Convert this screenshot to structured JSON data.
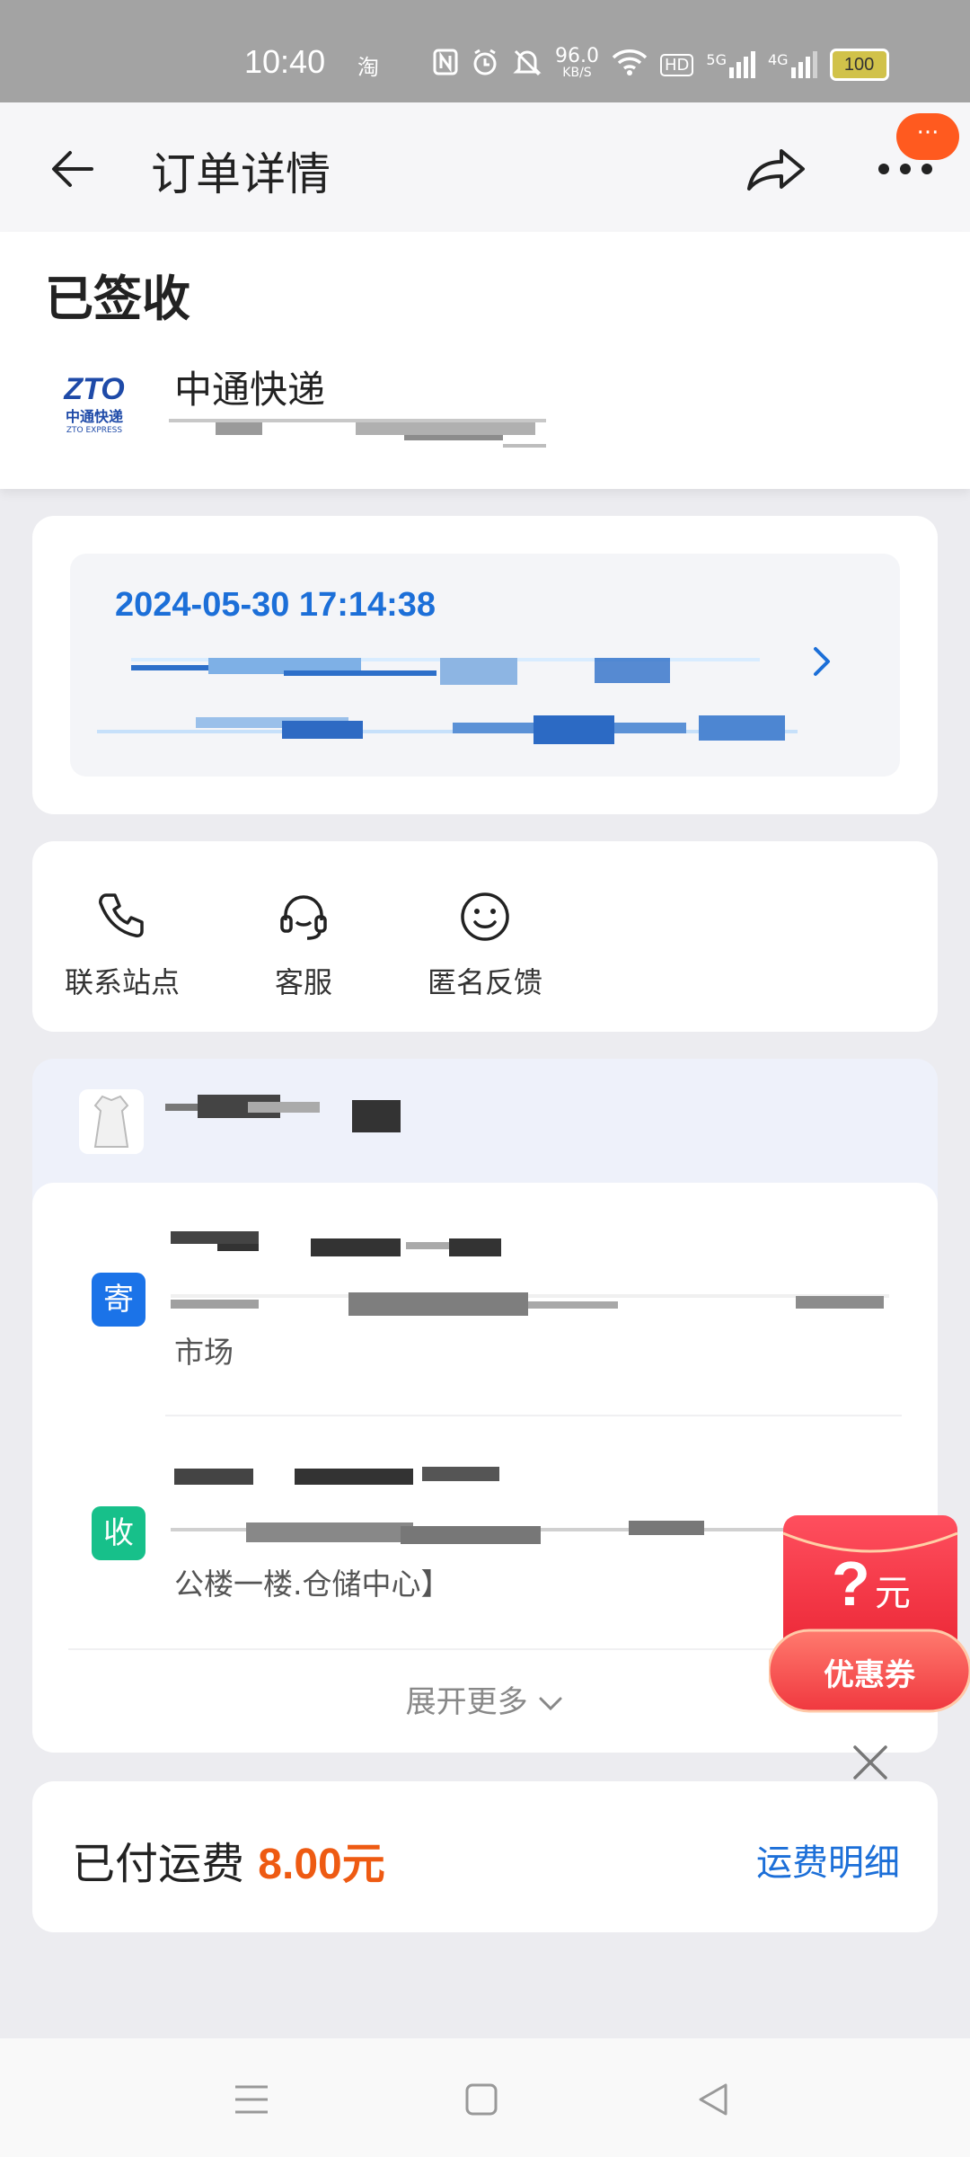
{
  "status_bar": {
    "time": "10:40",
    "app_icon": "淘",
    "network_speed": "96.0",
    "network_unit": "KB/S",
    "hd": "HD",
    "signal_1": "5G",
    "signal_2": "4G",
    "battery": "100"
  },
  "header": {
    "title": "订单详情",
    "badge": "···"
  },
  "shipment": {
    "status": "已签收",
    "carrier_name": "中通快递",
    "carrier_logo": "ZTO",
    "carrier_logo_sub": "中通快递",
    "carrier_logo_en": "ZTO EXPRESS"
  },
  "tracking": {
    "latest_time": "2024-05-30 17:14:38"
  },
  "actions": [
    {
      "label": "联系站点",
      "icon": "phone-icon"
    },
    {
      "label": "客服",
      "icon": "headset-icon"
    },
    {
      "label": "匿名反馈",
      "icon": "smiley-icon"
    }
  ],
  "sender": {
    "tag": "寄",
    "address_tail": "市场"
  },
  "receiver": {
    "tag": "收",
    "address_tail": "公楼一楼.仓储中心】"
  },
  "expand_more": "展开更多",
  "coupon": {
    "amount": "?",
    "unit": "元",
    "label": "优惠券"
  },
  "fee": {
    "label": "已付运费",
    "amount": "8.00元",
    "detail_link": "运费明细"
  },
  "colors": {
    "accent_blue": "#1c6fd8",
    "accent_orange": "#ee5a12",
    "sender_tag": "#1b73e8",
    "receiver_tag": "#17c08a"
  }
}
